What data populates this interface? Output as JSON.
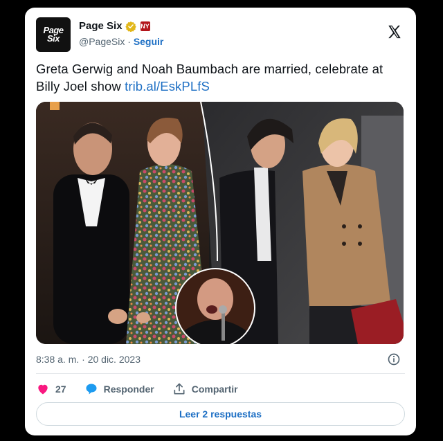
{
  "account": {
    "avatar_line1": "Page",
    "avatar_line2": "Six",
    "name": "Page Six",
    "affiliate_badge": "NY",
    "handle": "@PageSix",
    "separator": "·",
    "follow_label": "Seguir"
  },
  "tweet": {
    "text": "Greta Gerwig and Noah Baumbach are married, celebrate at Billy Joel show",
    "link": "trib.al/EskPLfS",
    "timestamp": "8:38 a. m. · 20 dic. 2023"
  },
  "actions": {
    "likes": "27",
    "reply_label": "Responder",
    "share_label": "Compartir"
  },
  "replies_button": "Leer 2 respuestas",
  "icons": {
    "verified": "verified-badge-icon",
    "x_logo": "x-logo-icon",
    "info": "info-icon",
    "like": "heart-icon",
    "reply": "speech-bubble-icon",
    "share": "share-icon"
  },
  "colors": {
    "link": "#1d6fc4",
    "like": "#f91880",
    "verified": "#e2b719"
  }
}
